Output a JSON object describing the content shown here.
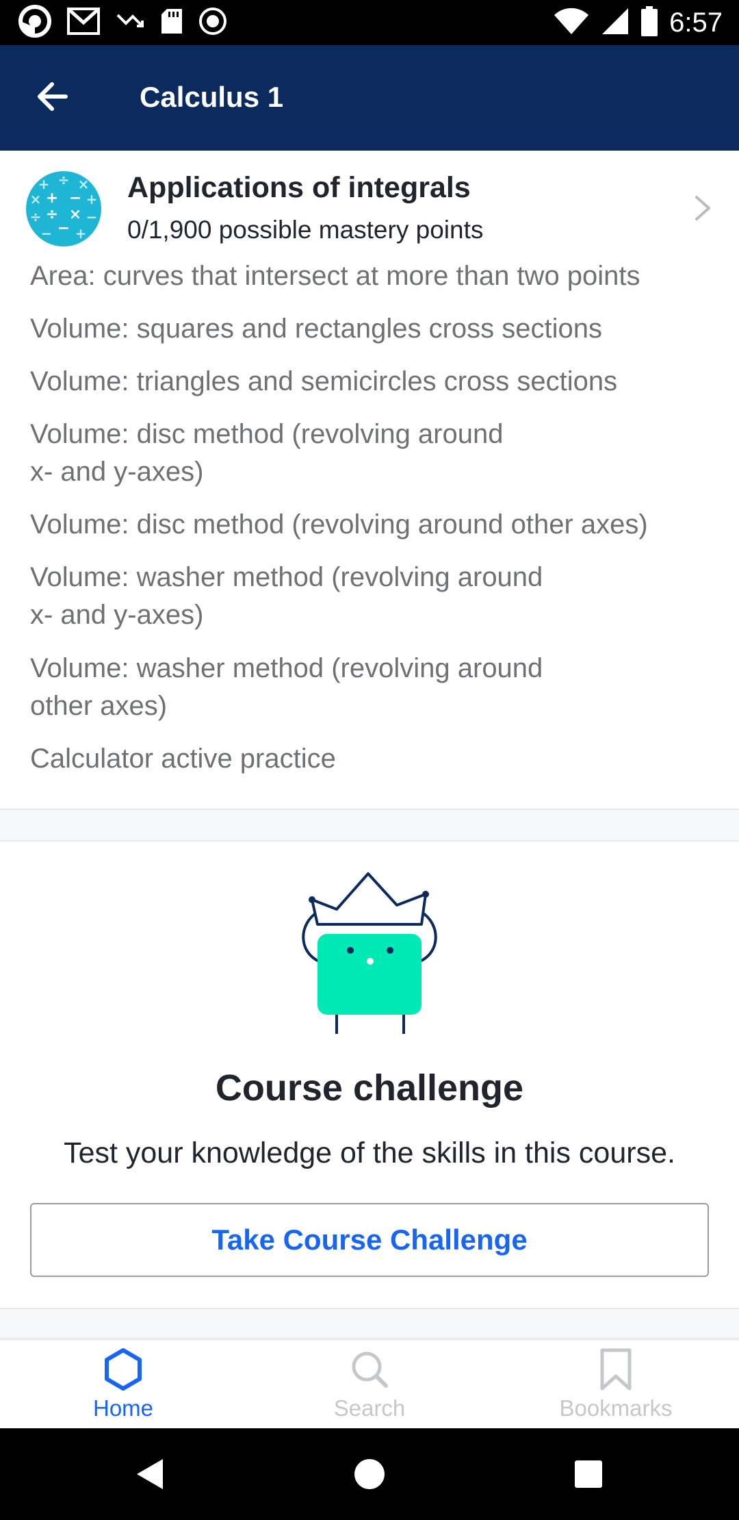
{
  "status_bar": {
    "time": "6:57",
    "icons": [
      "app-notification-icon",
      "gmail-icon",
      "missed-call-icon",
      "sd-card-icon",
      "record-icon",
      "wifi-icon",
      "signal-icon",
      "battery-icon"
    ]
  },
  "app_bar": {
    "title": "Calculus 1",
    "back_icon": "arrow-left-icon"
  },
  "unit": {
    "title": "Applications of integrals",
    "mastery": "0/1,900 possible mastery points",
    "icon": "math-operators-icon",
    "icon_color": "#1fb6d6"
  },
  "skills": [
    {
      "lines": [
        "Area: curves that intersect at more than two points"
      ]
    },
    {
      "lines": [
        "Volume: squares and rectangles cross sections"
      ]
    },
    {
      "lines": [
        "Volume: triangles and semicircles cross sections"
      ]
    },
    {
      "lines": [
        "Volume: disc method (revolving around",
        "x- and y-axes)"
      ]
    },
    {
      "lines": [
        "Volume: disc method (revolving around other axes)"
      ]
    },
    {
      "lines": [
        "Volume: washer method (revolving around",
        "x- and y-axes)"
      ]
    },
    {
      "lines": [
        "Volume: washer method (revolving around",
        "other axes)"
      ]
    },
    {
      "lines": [
        "Calculator active practice"
      ]
    }
  ],
  "challenge": {
    "title": "Course challenge",
    "description": "Test your knowledge of the skills in this course.",
    "button_label": "Take Course Challenge",
    "illustration": "crowned-character-illustration"
  },
  "bottom_nav": {
    "items": [
      {
        "label": "Home",
        "icon": "hexagon-home-icon",
        "active": true
      },
      {
        "label": "Search",
        "icon": "search-icon",
        "active": false
      },
      {
        "label": "Bookmarks",
        "icon": "bookmark-icon",
        "active": false
      }
    ]
  },
  "colors": {
    "app_bar": "#0b2a5e",
    "accent": "#1865f2",
    "character": "#00e9b4"
  }
}
